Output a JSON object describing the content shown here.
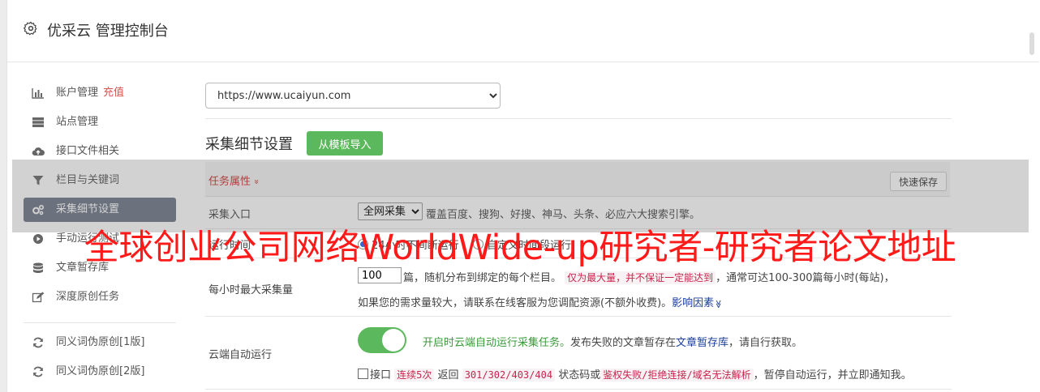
{
  "header": {
    "title": "优采云 管理控制台",
    "icon": "gear-icon"
  },
  "sidebar": {
    "items": [
      {
        "label": "账户管理",
        "badge": "充值",
        "icon": "bar-chart-icon"
      },
      {
        "label": "站点管理",
        "icon": "server-icon"
      },
      {
        "label": "接口文件相关",
        "icon": "cloud-upload-icon"
      },
      {
        "label": "栏目与关键词",
        "icon": "filter-icon"
      },
      {
        "label": "采集细节设置",
        "icon": "gears-icon",
        "active": true
      },
      {
        "label": "手动运行测试",
        "icon": "play-circle-icon"
      },
      {
        "label": "文章暂存库",
        "icon": "database-icon"
      },
      {
        "label": "深度原创任务",
        "icon": "edit-icon"
      },
      {
        "label": "同义词伪原创[1版]",
        "icon": "refresh-icon"
      },
      {
        "label": "同义词伪原创[2版]",
        "icon": "refresh-icon"
      }
    ]
  },
  "main": {
    "site_select": "https://www.ucaiyun.com",
    "section_title": "采集细节设置",
    "template_button": "从模板导入",
    "panel": {
      "title": "任务属性",
      "chevron": "»",
      "save_button": "快速保存"
    },
    "collect_entry": {
      "label": "采集入口",
      "select_value": "全网采集",
      "desc": "覆盖百度、搜狗、好搜、神马、头条、必应六大搜索引擎。"
    },
    "run_time": {
      "label": "运行时间",
      "option1": "24小时不间断运行",
      "option2": "自定义时间段运行"
    },
    "max_collect": {
      "label": "每小时最大采集量",
      "value": "100",
      "text1": "篇，随机分布到绑定的每个栏目。",
      "code1": "仅为最大量，并不保证一定能达到",
      "text2": "，通常可达100-300篇每小时(每站)，",
      "text3": "如果您的需求量较大，请联系在线客服为您调配资源(不额外收费)。",
      "link": "影响因素",
      "link_arrow": "≫"
    },
    "cloud_run": {
      "label": "云端自动运行",
      "enabled": true,
      "green_text": "开启时云端自动运行采集任务。",
      "text1": "发布失败的文章暂存在",
      "link": "文章暂存库",
      "text2": "，请自行获取。",
      "cb_label": "接口",
      "code1": "连续5次",
      "text3": "返回",
      "code2": "301/302/403/404",
      "text4": "状态码或",
      "code3": "鉴权失败/拒绝连接/域名无法解析",
      "text5": "，暂停自动运行，并立即通知我。"
    }
  },
  "watermark": "全球创业公司网络WorldWide-up研究者-研究者论文地址",
  "colors": {
    "active_nav": "#6c7686",
    "green": "#5cb85c",
    "danger": "#c9302c",
    "code": "#c7254e",
    "watermark": "#ff1a1a"
  }
}
